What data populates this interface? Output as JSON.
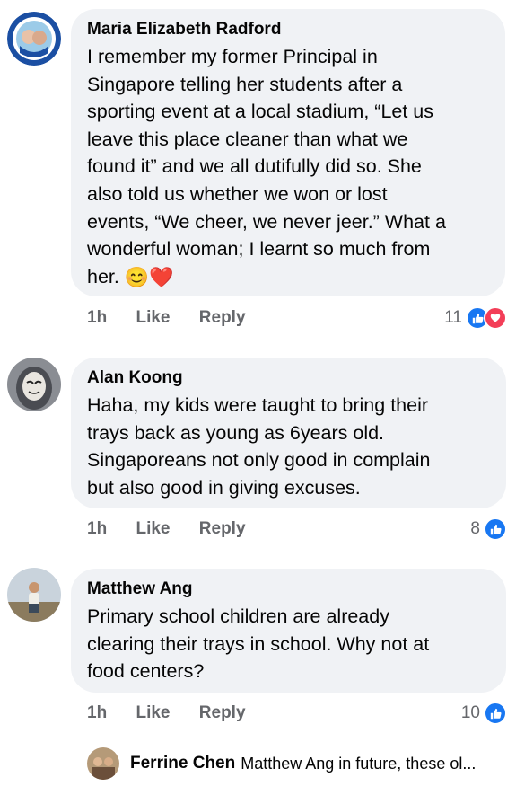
{
  "comments": [
    {
      "author": "Maria Elizabeth Radford",
      "text": "I remember my former Principal in\nSingapore telling her students after a\nsporting event at a local stadium, “Let us\nleave this place cleaner than what we\nfound it” and we all dutifully did so. She\nalso told us whether we won or lost\nevents, “We cheer, we never jeer.” What a\nwonderful woman; I learnt so much from\nher. ",
      "emojis": "😊❤️",
      "time": "1h",
      "like_label": "Like",
      "reply_label": "Reply",
      "reaction_count": "11"
    },
    {
      "author": "Alan Koong",
      "text": "Haha, my kids were taught to bring their\ntrays back as young as 6years old.\nSingaporeans not only good in complain\nbut also good in giving excuses.",
      "time": "1h",
      "like_label": "Like",
      "reply_label": "Reply",
      "reaction_count": "8"
    },
    {
      "author": "Matthew Ang",
      "text": "Primary school children are already\nclearing their trays in school. Why not at\nfood centers?",
      "time": "1h",
      "like_label": "Like",
      "reply_label": "Reply",
      "reaction_count": "10"
    }
  ],
  "reply_preview": {
    "author": "Ferrine Chen",
    "text": "Matthew Ang in future, these ol..."
  },
  "colors": {
    "like_blue": "#1877f2",
    "love_red": "#f33e58",
    "bubble_bg": "#f0f2f5",
    "meta_gray": "#65676b"
  }
}
